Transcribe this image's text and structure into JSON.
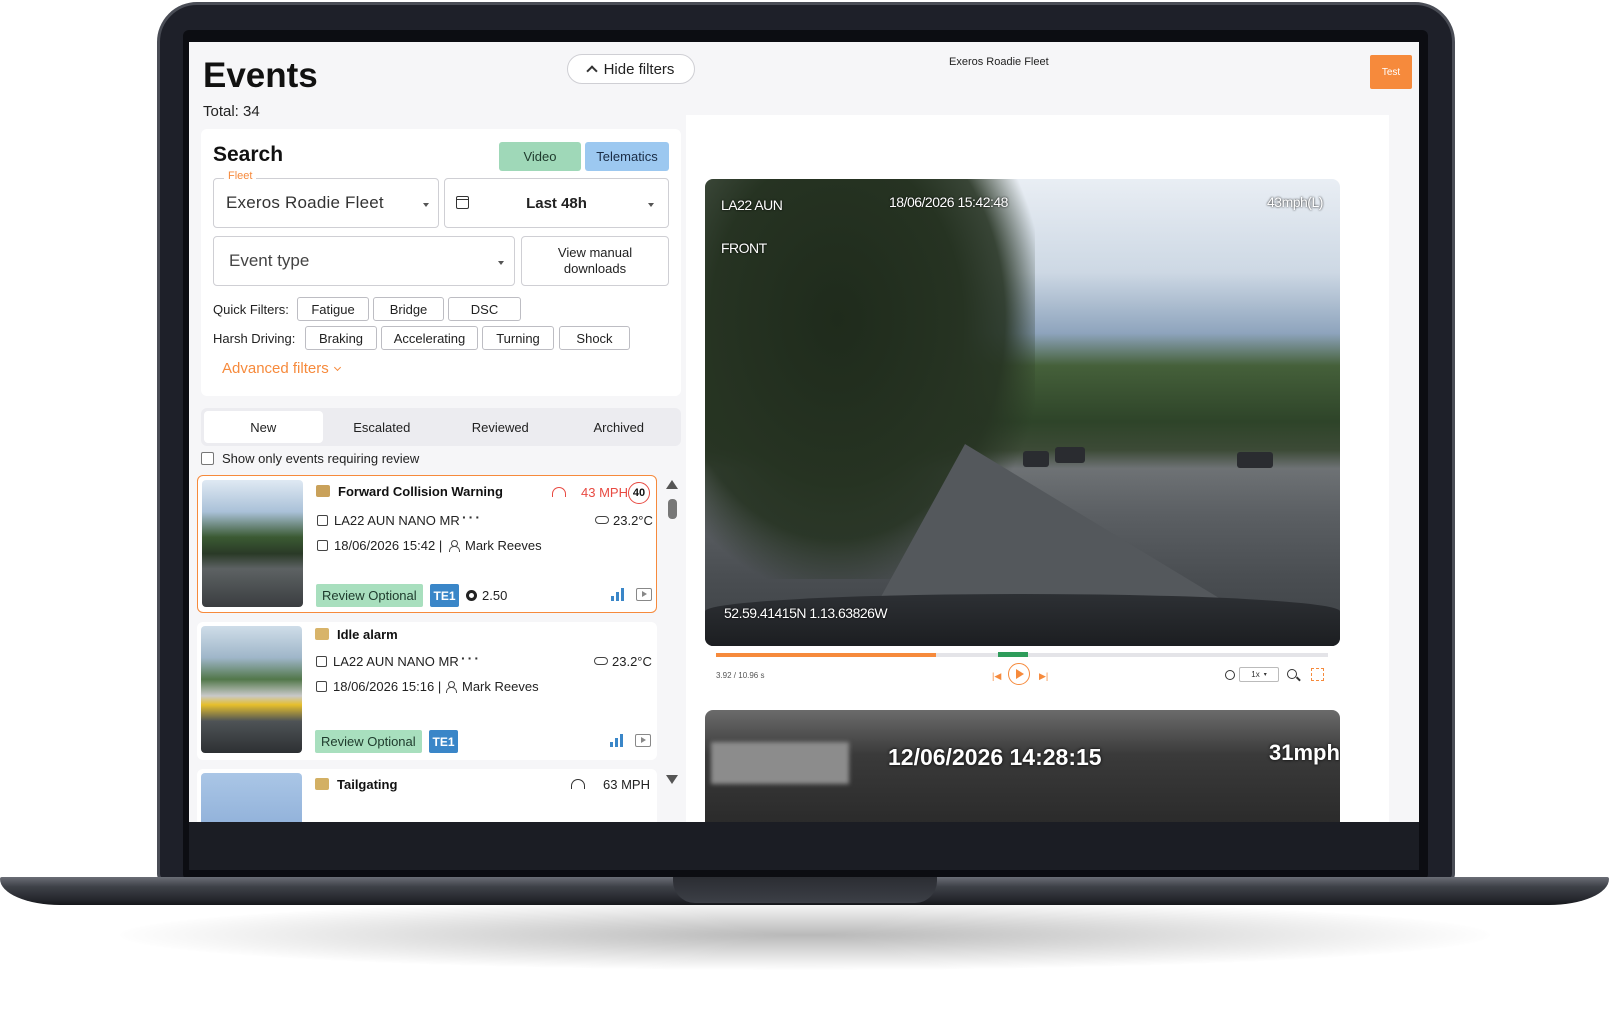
{
  "header": {
    "title": "Events",
    "total": "Total: 34",
    "hide_filters_label": "Hide filters",
    "fleet_name": "Exeros Roadie Fleet",
    "test_label": "Test"
  },
  "search": {
    "title": "Search",
    "segment_video": "Video",
    "segment_telematics": "Telematics",
    "fleet_legend": "Fleet",
    "fleet_value": "Exeros Roadie Fleet",
    "date_value": "Last 48h",
    "event_type_placeholder": "Event type",
    "manual_downloads_line1": "View manual",
    "manual_downloads_line2": "downloads",
    "quick_filters_label": "Quick Filters:",
    "quick_filters": [
      "Fatigue",
      "Bridge",
      "DSC"
    ],
    "harsh_driving_label": "Harsh Driving:",
    "harsh_filters": [
      "Braking",
      "Accelerating",
      "Turning",
      "Shock"
    ],
    "advanced_filters_label": "Advanced filters"
  },
  "tabs": [
    "New",
    "Escalated",
    "Reviewed",
    "Archived"
  ],
  "review_only_label": "Show only events requiring review",
  "events": [
    {
      "title": "Forward Collision Warning",
      "speed": "43 MPH",
      "limit": "40",
      "vehicle": "LA22 AUN NANO MR",
      "temperature": "23.2°C",
      "datetime": "18/06/2026 15:42 |",
      "driver": "Mark Reeves",
      "review": "Review Optional",
      "te": "TE1",
      "score": "2.50"
    },
    {
      "title": "Idle alarm",
      "vehicle": "LA22 AUN NANO MR",
      "temperature": "23.2°C",
      "datetime": "18/06/2026 15:16 |",
      "driver": "Mark Reeves",
      "review": "Review Optional",
      "te": "TE1"
    },
    {
      "title": "Tailgating",
      "speed": "63 MPH"
    }
  ],
  "video": {
    "plate": "LA22 AUN",
    "timestamp": "18/06/2026 15:42:48",
    "speed": "43mph(L)",
    "camera": "FRONT",
    "gps": "52.59.41415N 1.13.63826W",
    "time_readout": "3.92 / 10.96 s",
    "playback_rate": "1x",
    "progress": 0.36,
    "event_start": 0.461,
    "prev_label": "|◀",
    "next_label": "▶|"
  },
  "video2": {
    "timestamp": "12/06/2026 14:28:15",
    "speed": "31mph"
  },
  "colors": {
    "accent": "#f68a3c",
    "video_segment": "#9fd8b8",
    "telematics_segment": "#9cc8f0",
    "alert_red": "#e84a42",
    "te_badge": "#3a86c8"
  }
}
